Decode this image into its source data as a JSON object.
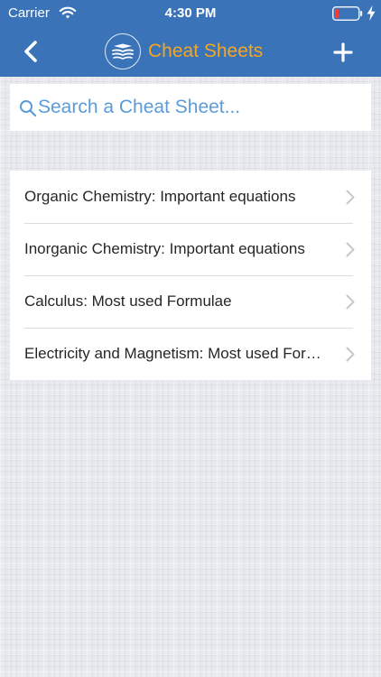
{
  "status_bar": {
    "carrier": "Carrier",
    "time": "4:30 PM",
    "icons": [
      "wifi-icon",
      "battery-icon",
      "charging-icon"
    ]
  },
  "header": {
    "title": "Cheat Sheets",
    "title_color": "#f5a623",
    "background_color": "#3a73b7",
    "back_icon": "chevron-left-icon",
    "add_icon": "plus-icon",
    "logo_icon": "book-logo-icon"
  },
  "search": {
    "placeholder": "Search a Cheat Sheet...",
    "value": "",
    "icon": "search-icon",
    "placeholder_color": "#5b9bd9"
  },
  "cheat_sheets": {
    "items": [
      {
        "label": "Organic Chemistry: Important equations"
      },
      {
        "label": "Inorganic Chemistry: Important equations"
      },
      {
        "label": "Calculus: Most used Formulae"
      },
      {
        "label": "Electricity and Magnetism: Most used Formulae"
      }
    ],
    "item_icon": "chevron-right-icon"
  }
}
